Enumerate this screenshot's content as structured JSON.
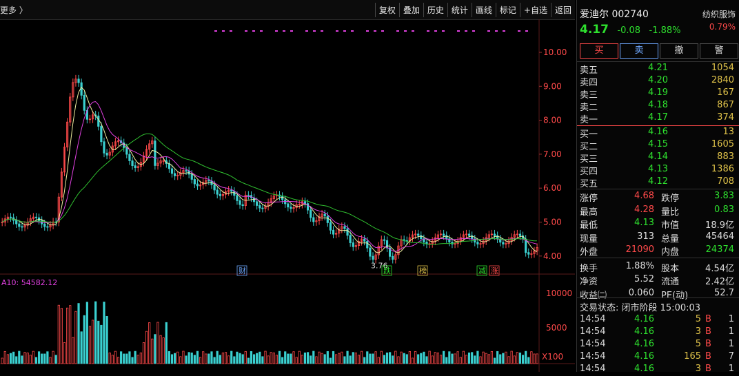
{
  "toolbar": {
    "left_text": "更多 〉",
    "buttons": [
      "复权",
      "叠加",
      "历史",
      "统计",
      "画线",
      "标记",
      "+自选",
      "返回"
    ]
  },
  "main_chart": {
    "price_ticks": [
      "10.00",
      "9.00",
      "8.00",
      "7.00",
      "6.00",
      "5.00",
      "4.00"
    ],
    "min_price_label": "3.76",
    "markers": [
      {
        "text": "财",
        "color": "#6fa8ff"
      },
      {
        "text": "跌",
        "color": "#2ee02e"
      },
      {
        "text": "榜",
        "color": "#e0c34a"
      },
      {
        "text": "减",
        "color": "#2ee02e"
      },
      {
        "text": "涨",
        "color": "#ff4a4a"
      }
    ],
    "volume_label": "A10: 54582.12",
    "volume_ticks": [
      "10000",
      "5000"
    ],
    "volume_unit": "X100"
  },
  "quote": {
    "name": "爱迪尔 002740",
    "industry": "纺织服饰",
    "industry_pct": "0.79%",
    "price": "4.17",
    "change": "-0.08",
    "change_pct": "-1.88%",
    "actions": [
      "买",
      "卖",
      "撤",
      "警"
    ],
    "asks": [
      {
        "label": "卖五",
        "price": "4.21",
        "vol": "1054"
      },
      {
        "label": "卖四",
        "price": "4.20",
        "vol": "2840"
      },
      {
        "label": "卖三",
        "price": "4.19",
        "vol": "167"
      },
      {
        "label": "卖二",
        "price": "4.18",
        "vol": "867"
      },
      {
        "label": "卖一",
        "price": "4.17",
        "vol": "374"
      }
    ],
    "bids": [
      {
        "label": "买一",
        "price": "4.16",
        "vol": "13"
      },
      {
        "label": "买二",
        "price": "4.15",
        "vol": "1605"
      },
      {
        "label": "买三",
        "price": "4.14",
        "vol": "883"
      },
      {
        "label": "买四",
        "price": "4.13",
        "vol": "1386"
      },
      {
        "label": "买五",
        "price": "4.12",
        "vol": "708"
      }
    ],
    "stats": [
      {
        "l1": "涨停",
        "v1": "4.68",
        "c1": "r",
        "l2": "跌停",
        "v2": "3.83",
        "c2": "g"
      },
      {
        "l1": "最高",
        "v1": "4.28",
        "c1": "r",
        "l2": "量比",
        "v2": "0.83",
        "c2": "g"
      },
      {
        "l1": "最低",
        "v1": "4.13",
        "c1": "g",
        "l2": "市值",
        "v2": "18.9亿",
        "c2": "w"
      },
      {
        "l1": "现量",
        "v1": "313",
        "c1": "w",
        "l2": "总量",
        "v2": "45464",
        "c2": "w"
      },
      {
        "l1": "外盘",
        "v1": "21090",
        "c1": "r",
        "l2": "内盘",
        "v2": "24374",
        "c2": "g"
      },
      {
        "l1": "换手",
        "v1": "1.88%",
        "c1": "w",
        "l2": "股本",
        "v2": "4.54亿",
        "c2": "w"
      },
      {
        "l1": "净资",
        "v1": "5.52",
        "c1": "w",
        "l2": "流通",
        "v2": "2.42亿",
        "c2": "w"
      },
      {
        "l1": "收益㈡",
        "v1": "0.060",
        "c1": "w",
        "l2": "PE(动)",
        "v2": "52.7",
        "c2": "w"
      }
    ],
    "trade_status": "交易状态: 闭市阶段 15:00:03",
    "trades": [
      {
        "time": "14:54",
        "price": "4.16",
        "vol": "5",
        "side": "B",
        "n": "1"
      },
      {
        "time": "14:54",
        "price": "4.16",
        "vol": "3",
        "side": "B",
        "n": "1"
      },
      {
        "time": "14:54",
        "price": "4.16",
        "vol": "5",
        "side": "B",
        "n": "1"
      },
      {
        "time": "14:54",
        "price": "4.16",
        "vol": "165",
        "side": "B",
        "n": "7"
      },
      {
        "time": "14:54",
        "price": "4.16",
        "vol": "3",
        "side": "B",
        "n": "1"
      }
    ]
  },
  "colors": {
    "up": "#ff4a4a",
    "down": "#2ee02e",
    "ma1": "#f0f0a0",
    "ma2": "#e040e0",
    "ma3": "#30c030",
    "accent": "#e0c34a"
  }
}
